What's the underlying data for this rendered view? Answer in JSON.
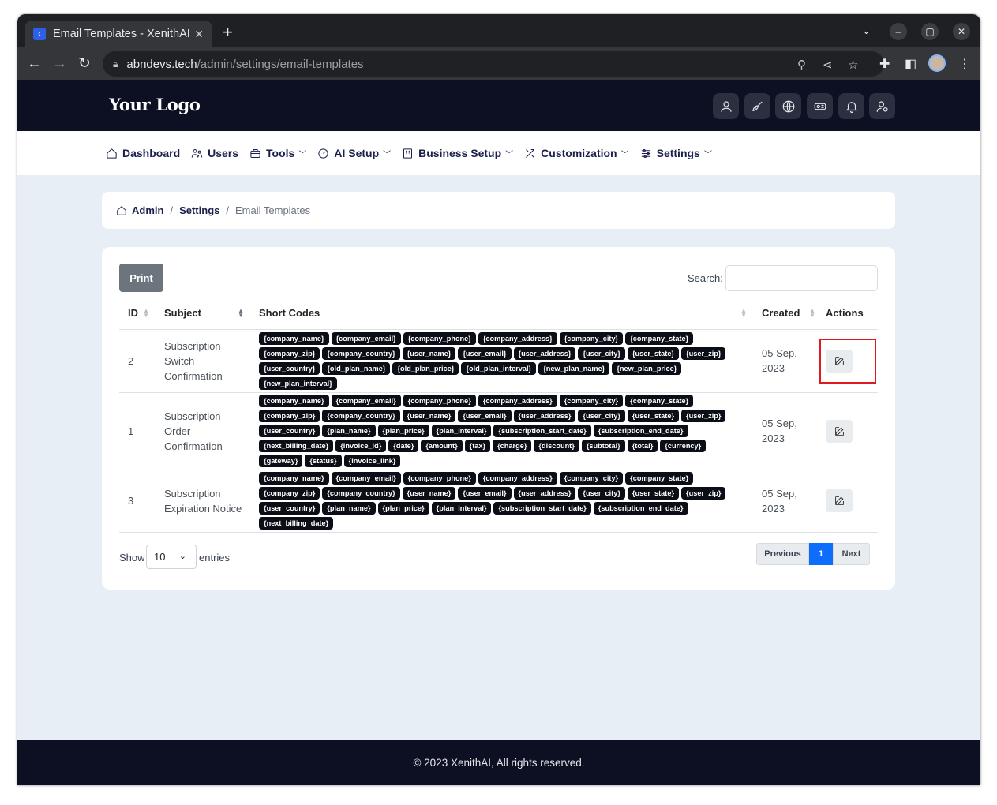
{
  "browser": {
    "tab_title": "Email Templates - XenithAI",
    "url_host": "abndevs.tech",
    "url_path": "/admin/settings/email-templates"
  },
  "site": {
    "logo": "Your Logo"
  },
  "nav": {
    "dashboard": "Dashboard",
    "users": "Users",
    "tools": "Tools",
    "ai_setup": "AI Setup",
    "business_setup": "Business Setup",
    "customization": "Customization",
    "settings": "Settings"
  },
  "breadcrumb": {
    "admin": "Admin",
    "settings": "Settings",
    "current": "Email Templates",
    "sep": "/"
  },
  "table": {
    "print_label": "Print",
    "search_label": "Search:",
    "headers": {
      "id": "ID",
      "subject": "Subject",
      "short_codes": "Short Codes",
      "created": "Created",
      "actions": "Actions"
    },
    "rows": [
      {
        "id": "2",
        "subject": "Subscription Switch Confirmation",
        "created": "05 Sep, 2023",
        "codes": [
          "{company_name}",
          "{company_email}",
          "{company_phone}",
          "{company_address}",
          "{company_city}",
          "{company_state}",
          "{company_zip}",
          "{company_country}",
          "{user_name}",
          "{user_email}",
          "{user_address}",
          "{user_city}",
          "{user_state}",
          "{user_zip}",
          "{user_country}",
          "{old_plan_name}",
          "{old_plan_price}",
          "{old_plan_interval}",
          "{new_plan_name}",
          "{new_plan_price}",
          "{new_plan_interval}"
        ]
      },
      {
        "id": "1",
        "subject": "Subscription Order Confirmation",
        "created": "05 Sep, 2023",
        "codes": [
          "{company_name}",
          "{company_email}",
          "{company_phone}",
          "{company_address}",
          "{company_city}",
          "{company_state}",
          "{company_zip}",
          "{company_country}",
          "{user_name}",
          "{user_email}",
          "{user_address}",
          "{user_city}",
          "{user_state}",
          "{user_zip}",
          "{user_country}",
          "{plan_name}",
          "{plan_price}",
          "{plan_interval}",
          "{subscription_start_date}",
          "{subscription_end_date}",
          "{next_billing_date}",
          "{invoice_id}",
          "{date}",
          "{amount}",
          "{tax}",
          "{charge}",
          "{discount}",
          "{subtotal}",
          "{total}",
          "{currency}",
          "{gateway}",
          "{status}",
          "{invoice_link}"
        ]
      },
      {
        "id": "3",
        "subject": "Subscription Expiration Notice",
        "created": "05 Sep, 2023",
        "codes": [
          "{company_name}",
          "{company_email}",
          "{company_phone}",
          "{company_address}",
          "{company_city}",
          "{company_state}",
          "{company_zip}",
          "{company_country}",
          "{user_name}",
          "{user_email}",
          "{user_address}",
          "{user_city}",
          "{user_state}",
          "{user_zip}",
          "{user_country}",
          "{plan_name}",
          "{plan_price}",
          "{plan_interval}",
          "{subscription_start_date}",
          "{subscription_end_date}",
          "{next_billing_date}"
        ]
      }
    ],
    "show_label": "Show",
    "page_length": "10",
    "entries_label": "entries",
    "pagination": {
      "previous": "Previous",
      "current": "1",
      "next": "Next"
    }
  },
  "footer": {
    "text": "© 2023 XenithAI, All rights reserved."
  },
  "colors": {
    "header_bg": "#0c1022",
    "accent": "#0d6efd",
    "highlight": "#e0191e"
  }
}
